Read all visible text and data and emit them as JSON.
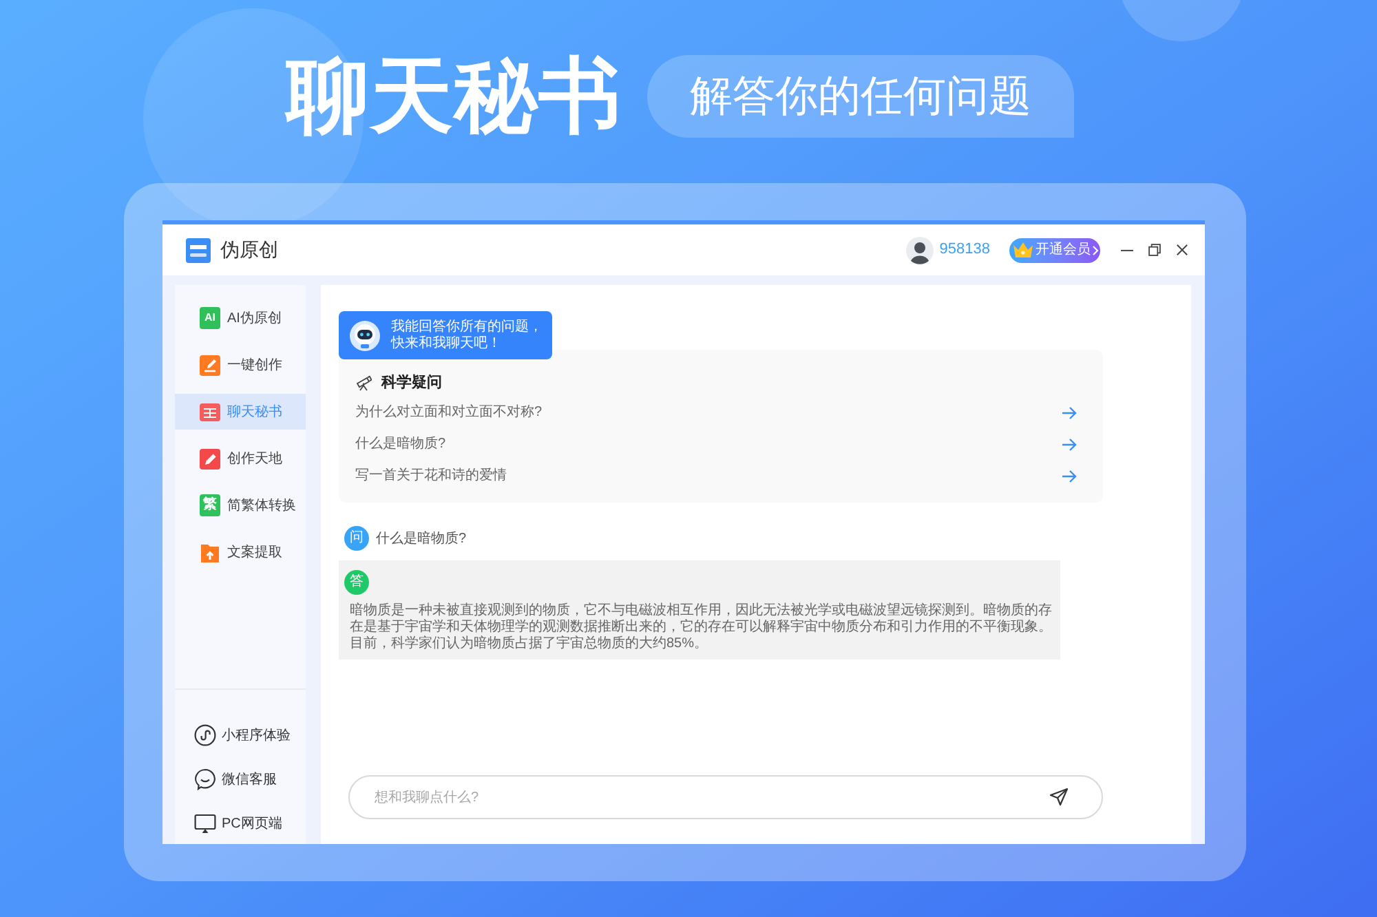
{
  "banner": {
    "title": "聊天秘书",
    "subtitle": "解答你的任何问题"
  },
  "window": {
    "app_name": "伪原创",
    "user_id": "958138",
    "vip_button": "开通会员"
  },
  "sidebar": {
    "items": [
      {
        "label": "AI伪原创",
        "selected": false,
        "icon_text": "AI"
      },
      {
        "label": "一键创作",
        "selected": false
      },
      {
        "label": "聊天秘书",
        "selected": true
      },
      {
        "label": "创作天地",
        "selected": false
      },
      {
        "label": "简繁体转换",
        "selected": false,
        "icon_text": "繁"
      },
      {
        "label": "文案提取",
        "selected": false
      }
    ],
    "footer_links": [
      "小程序体验",
      "微信客服",
      "PC网页端"
    ]
  },
  "chat": {
    "greeting_lines": [
      "我能回答你所有的问题，",
      "快来和我聊天吧！"
    ],
    "suggestions": {
      "title": "科学疑问",
      "items": [
        "为什么对立面和对立面不对称?",
        "什么是暗物质?",
        "写一首关于花和诗的爱情"
      ]
    },
    "messages": [
      {
        "kind": "question",
        "badge": "问",
        "text": "什么是暗物质?"
      },
      {
        "kind": "answer",
        "badge": "答",
        "text": "暗物质是一种未被直接观测到的物质，它不与电磁波相互作用，因此无法被光学或电磁波望远镜探测到。暗物质的存在是基于宇宙学和天体物理学的观测数据推断出来的，它的存在可以解释宇宙中物质分布和引力作用的不平衡现象。目前，科学家们认为暗物质占据了宇宙总物质的大约85%。"
      }
    ]
  },
  "input": {
    "placeholder": "想和我聊点什么?"
  }
}
